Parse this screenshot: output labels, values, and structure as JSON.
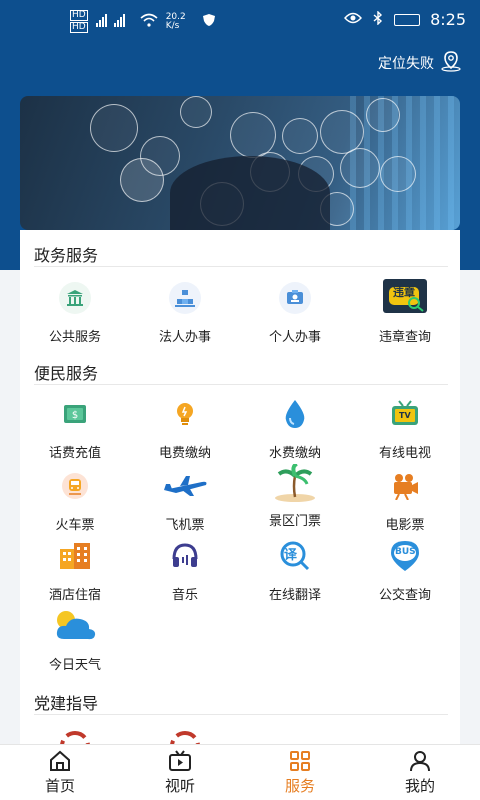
{
  "status_bar": {
    "sim1": "HD",
    "sim2": "HD",
    "net_speed": "20.2 K/s",
    "time": "8:25"
  },
  "location": {
    "label": "定位失败"
  },
  "sections": {
    "gov": {
      "title": "政务服务",
      "items": [
        {
          "label": "公共服务",
          "icon": "bank-icon"
        },
        {
          "label": "法人办事",
          "icon": "org-chart-icon"
        },
        {
          "label": "个人办事",
          "icon": "id-card-icon"
        },
        {
          "label": "违章查询",
          "icon": "violation-badge-icon",
          "badge_text": "违章"
        }
      ]
    },
    "life": {
      "title": "便民服务",
      "items": [
        {
          "label": "话费充值",
          "icon": "dollar-note-icon"
        },
        {
          "label": "电费缴纳",
          "icon": "lightbulb-icon"
        },
        {
          "label": "水费缴纳",
          "icon": "water-drop-icon"
        },
        {
          "label": "有线电视",
          "icon": "tv-icon",
          "badge_text": "TV"
        },
        {
          "label": "火车票",
          "icon": "train-icon"
        },
        {
          "label": "飞机票",
          "icon": "airplane-icon"
        },
        {
          "label": "景区门票",
          "icon": "palm-island-icon"
        },
        {
          "label": "电影票",
          "icon": "film-camera-icon"
        },
        {
          "label": "酒店住宿",
          "icon": "hotel-icon"
        },
        {
          "label": "音乐",
          "icon": "headphones-icon"
        },
        {
          "label": "在线翻译",
          "icon": "translate-icon",
          "badge_text": "译"
        },
        {
          "label": "公交查询",
          "icon": "bus-pin-icon",
          "badge_text": "BUS"
        },
        {
          "label": "今日天气",
          "icon": "weather-icon"
        }
      ]
    },
    "party": {
      "title": "党建指导"
    }
  },
  "tabbar": {
    "items": [
      {
        "label": "首页",
        "icon": "home-icon"
      },
      {
        "label": "视听",
        "icon": "video-icon"
      },
      {
        "label": "服务",
        "icon": "grid-icon",
        "active": true
      },
      {
        "label": "我的",
        "icon": "user-icon"
      }
    ]
  },
  "colors": {
    "header_bg": "#0d4f8e",
    "active_tab": "#e67e22"
  }
}
